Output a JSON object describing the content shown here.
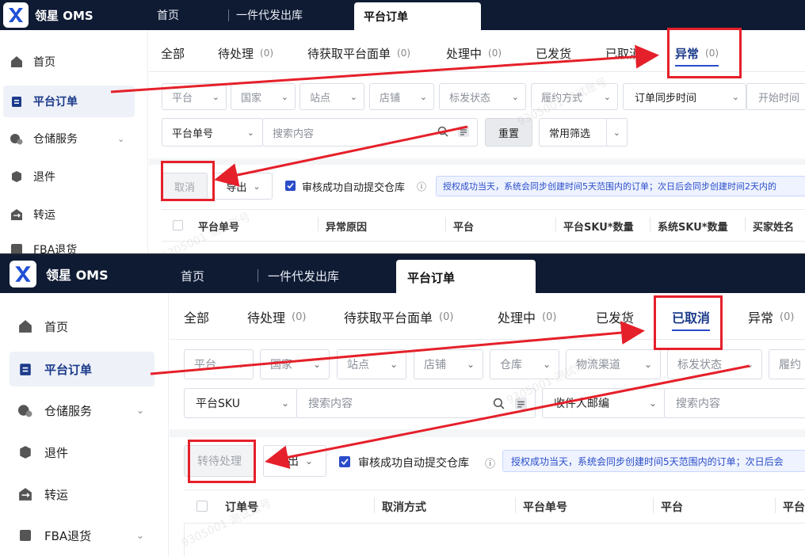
{
  "app": {
    "name": "领星 OMS"
  },
  "top_tabs": [
    "首页",
    "一件代发出库",
    "平台订单"
  ],
  "sidebar": {
    "items": [
      {
        "label": "首页",
        "icon": "home-icon"
      },
      {
        "label": "平台订单",
        "icon": "clipboard-icon"
      },
      {
        "label": "仓储服务",
        "icon": "warehouse-icon"
      },
      {
        "label": "退件",
        "icon": "return-box-icon"
      },
      {
        "label": "转运",
        "icon": "transfer-icon"
      },
      {
        "label": "FBA退货",
        "icon": "amazon-icon"
      }
    ]
  },
  "status_tabs": {
    "all": "全部",
    "pending": "待处理",
    "awaiting_label": "待获取平台面单",
    "processing": "处理中",
    "shipped": "已发货",
    "cancelled": "已取消",
    "exception": "异常",
    "count": "(0)"
  },
  "screen1": {
    "filters": [
      "平台",
      "国家",
      "站点",
      "店铺",
      "标发状态",
      "履约方式",
      "订单同步时间",
      "开始时间"
    ],
    "search_field": "平台单号",
    "search_placeholder": "搜索内容",
    "reset": "重置",
    "common_filter": "常用筛选",
    "action_button": "取消",
    "export": "导出",
    "auto_submit": "审核成功自动提交仓库",
    "info": "授权成功当天，系统会同步创建时间5天范围内的订单；次日后会同步创建时间2天内的",
    "columns": [
      "平台单号",
      "异常原因",
      "平台",
      "平台SKU*数量",
      "系统SKU*数量",
      "买家姓名"
    ]
  },
  "screen2": {
    "filters": [
      "平台",
      "国家",
      "站点",
      "店铺",
      "仓库",
      "物流渠道",
      "标发状态",
      "履约"
    ],
    "search_field": "平台SKU",
    "search_placeholder": "搜索内容",
    "postcode_field": "收件人邮编",
    "postcode_placeholder": "搜索内容",
    "action_button": "转待处理",
    "export": "导出",
    "auto_submit": "审核成功自动提交仓库",
    "info": "授权成功当天，系统会同步创建时间5天范围内的订单；次日后会",
    "columns": [
      "订单号",
      "取消方式",
      "平台单号",
      "平台",
      "平台"
    ]
  },
  "watermark": "9305001 测试账号",
  "colors": {
    "accent": "#2a4cc9",
    "topbar": "#0f1b33",
    "annotation": "#e5202a"
  }
}
